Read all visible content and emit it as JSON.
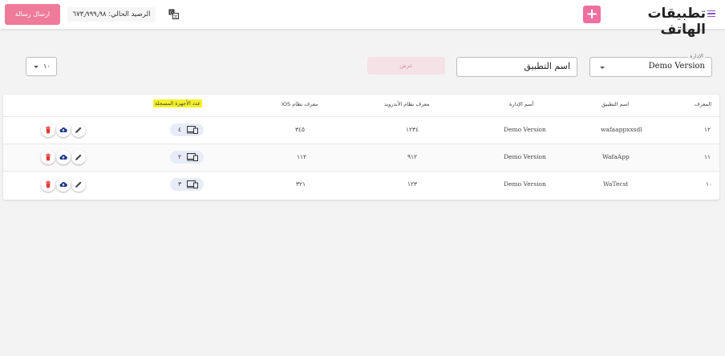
{
  "header": {
    "title": "تطبيقات الهاتف",
    "add_icon": "+",
    "balance": "الرصيد الحالي: ٦٧٣٫٩٩٩٫٩٨",
    "send_message": "ارسال رسالة",
    "icons": [
      "menu-icon",
      "translate-icon"
    ]
  },
  "filters": {
    "app_select": {
      "legend": "الإدارة",
      "value": "Demo Version"
    },
    "app_name": {
      "value": "اسم التطبيق"
    },
    "show_button": "عرض",
    "page_size": "١٠"
  },
  "table": {
    "columns": {
      "id": "المعرف",
      "app_name": "اسم التطبيق",
      "admin_name": "أسم الإدارة",
      "android_id": "معرف نظام الأندرويد",
      "ios_id": "معرف نظام IOS",
      "devices": "عدد الأجهزة المسجلة"
    },
    "rows": [
      {
        "id": "١٢",
        "app_name": "wafaappxxsdl",
        "admin_name": "Demo Version",
        "android_id": "١٢٣٤",
        "ios_id": "٣٤٥",
        "devices": "٤"
      },
      {
        "id": "١١",
        "app_name": "WafaApp",
        "admin_name": "Demo Version",
        "android_id": "٩١٢",
        "ios_id": "١١٢",
        "devices": "٢"
      },
      {
        "id": "١٠",
        "app_name": "WaTecst",
        "admin_name": "Demo Version",
        "android_id": "١٢٣",
        "ios_id": "٣٢١",
        "devices": "٣"
      }
    ]
  },
  "colors": {
    "accent": "#ee6fa0",
    "highlight": "#f4f12a",
    "delete": "#e53935",
    "upload": "#1e3a8a"
  }
}
